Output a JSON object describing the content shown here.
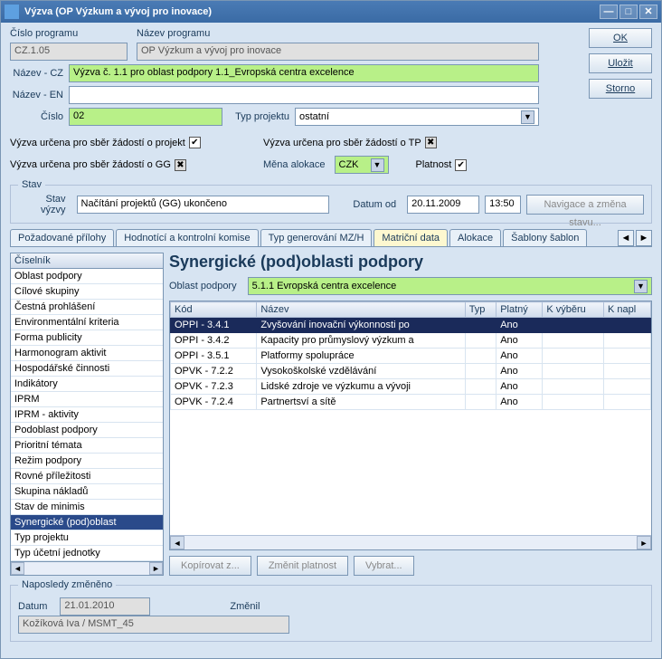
{
  "window": {
    "title": "Výzva   (OP Výzkum a vývoj pro inovace)"
  },
  "buttons": {
    "ok": "OK",
    "save": "Uložit",
    "cancel": "Storno",
    "nav": "Navigace a změna stavu...",
    "copy": "Kopírovat z...",
    "change": "Změnit platnost",
    "select": "Vybrat..."
  },
  "form": {
    "cislo_programu_lbl": "Číslo programu",
    "cislo_programu": "CZ.1.05",
    "nazev_programu_lbl": "Název programu",
    "nazev_programu": "OP Výzkum a vývoj pro inovace",
    "nazev_cz_lbl": "Název - CZ",
    "nazev_cz": "Výzva č. 1.1 pro oblast podpory 1.1_Evropská centra excelence",
    "nazev_en_lbl": "Název - EN",
    "nazev_en": "",
    "cislo_lbl": "Číslo",
    "cislo": "02",
    "typ_projektu_lbl": "Typ projektu",
    "typ_projektu": "ostatní"
  },
  "checks": {
    "projekt": "Výzva určena pro sběr žádostí o projekt",
    "gg": "Výzva určena pro sběr žádostí o GG",
    "tp": "Výzva určena pro sběr žádostí o TP",
    "mena_lbl": "Měna alokace",
    "mena": "CZK",
    "platnost": "Platnost"
  },
  "stav": {
    "legend": "Stav",
    "stav_vyzvy_lbl": "Stav výzvy",
    "stav_vyzvy": "Načítání projektů (GG) ukončeno",
    "datum_od_lbl": "Datum od",
    "datum_od": "20.11.2009",
    "cas": "13:50"
  },
  "tabs": [
    "Požadované přílohy",
    "Hodnotící a kontrolní komise",
    "Typ generování MZ/H",
    "Matriční data",
    "Alokace",
    "Šablony šablon"
  ],
  "sidebar": {
    "header": "Číselník",
    "items": [
      "Oblast podpory",
      "Cílové skupiny",
      "Čestná prohlášení",
      "Environmentální kriteria",
      "Forma publicity",
      "Harmonogram aktivit",
      "Hospodářské činnosti",
      "Indikátory",
      "IPRM",
      "IPRM - aktivity",
      "Podoblast podpory",
      "Prioritní témata",
      "Režim podpory",
      "Rovné příležitosti",
      "Skupina nákladů",
      "Stav de minimis",
      "Synergické (pod)oblast",
      "Typ projektu",
      "Typ účetní jednotky"
    ],
    "selected": 16
  },
  "detail": {
    "heading": "Synergické (pod)oblasti podpory",
    "oblast_lbl": "Oblast podpory",
    "oblast": "5.1.1 Evropská centra excelence",
    "columns": [
      "Kód",
      "Název",
      "Typ",
      "Platný",
      "K výběru",
      "K napl"
    ],
    "rows": [
      {
        "kod": "OPPI - 3.4.1",
        "nazev": "Zvyšování inovační výkonnosti po",
        "typ": "",
        "platny": "Ano"
      },
      {
        "kod": "OPPI - 3.4.2",
        "nazev": "Kapacity pro průmyslový výzkum a",
        "typ": "",
        "platny": "Ano"
      },
      {
        "kod": "OPPI - 3.5.1",
        "nazev": "Platformy spolupráce",
        "typ": "",
        "platny": "Ano"
      },
      {
        "kod": "OPVK - 7.2.2",
        "nazev": "Vysokoškolské vzdělávání",
        "typ": "",
        "platny": "Ano"
      },
      {
        "kod": "OPVK - 7.2.3",
        "nazev": "Lidské zdroje ve výzkumu a vývoji",
        "typ": "",
        "platny": "Ano"
      },
      {
        "kod": "OPVK - 7.2.4",
        "nazev": "Partnertsví a sítě",
        "typ": "",
        "platny": "Ano"
      }
    ]
  },
  "footer": {
    "legend": "Naposledy změněno",
    "datum_lbl": "Datum",
    "datum": "21.01.2010",
    "zmenil_lbl": "Změnil",
    "zmenil": "Kožíková Iva  /  MSMT_45"
  }
}
